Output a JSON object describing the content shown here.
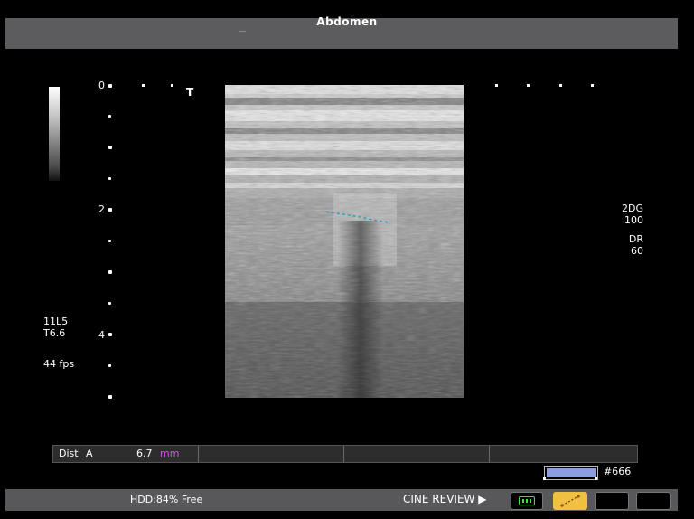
{
  "header": {
    "title": "Abdomen"
  },
  "depth_scale": {
    "labels": [
      "0",
      "2",
      "4"
    ]
  },
  "probe_info": {
    "probe": "11L5",
    "tissue": "T6.6",
    "frame_rate": "44 fps"
  },
  "marker": "T",
  "right_params": {
    "gain_label": "2DG",
    "gain_value": "100",
    "dr_label": "DR",
    "dr_value": "60"
  },
  "measurement": {
    "label": "Dist",
    "marker": "A",
    "value": "6.7",
    "unit": "mm"
  },
  "cine": {
    "frame": "#666"
  },
  "status": {
    "hdd": "HDD:84% Free",
    "cine_review": "CINE REVIEW ▶"
  },
  "icons": {
    "loop": "loop-icon",
    "caliper": "caliper-icon"
  },
  "colors": {
    "caliper": "#2aa0b8",
    "unit": "#c060d0",
    "cine_active": "#f0c040",
    "loop": "#40e040"
  }
}
